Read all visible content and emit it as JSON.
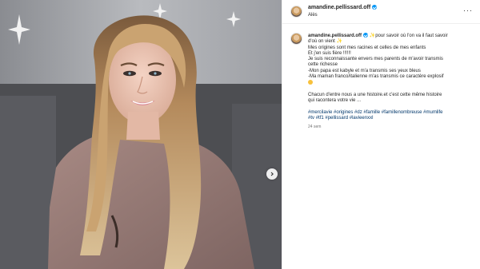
{
  "post": {
    "username": "amandine.pellissard.off",
    "location": "Alès"
  },
  "caption": {
    "username": "amandine.pellissard.off",
    "lines": [
      "pour savoir où l'on va il faut savoir",
      "d'où on vient",
      "Mes origines sont mes racines et celles de mes enfants",
      "Et j'en suis fière !!!!!!",
      "Je suis reconnaissante envers mes parents de m'avoir transmis",
      "cette richesse",
      "-Mon papa est kabyle et m'a transmis ses yeux bleus",
      "-Ma maman franco/italienne m'as transmis ce caractère explosif",
      "Chacun d'entre nous a une histoire.et c'est cette même histoire",
      "qui racontera votre vie ..."
    ],
    "hashtags_line1": [
      "#mercilavie",
      "#origines",
      "#dz",
      "#famille",
      "#famillenombreuse",
      "#mumlife"
    ],
    "hashtags_line2": [
      "#tv",
      "#tf1",
      "#pellissard",
      "#lavieenxxl"
    ],
    "time": "24 sem"
  },
  "icons": {
    "verified": "verified-badge-icon",
    "more": "more-options-icon",
    "next": "chevron-right-icon",
    "brand_color": "#0095f6",
    "hashtag_color": "#00376b"
  }
}
